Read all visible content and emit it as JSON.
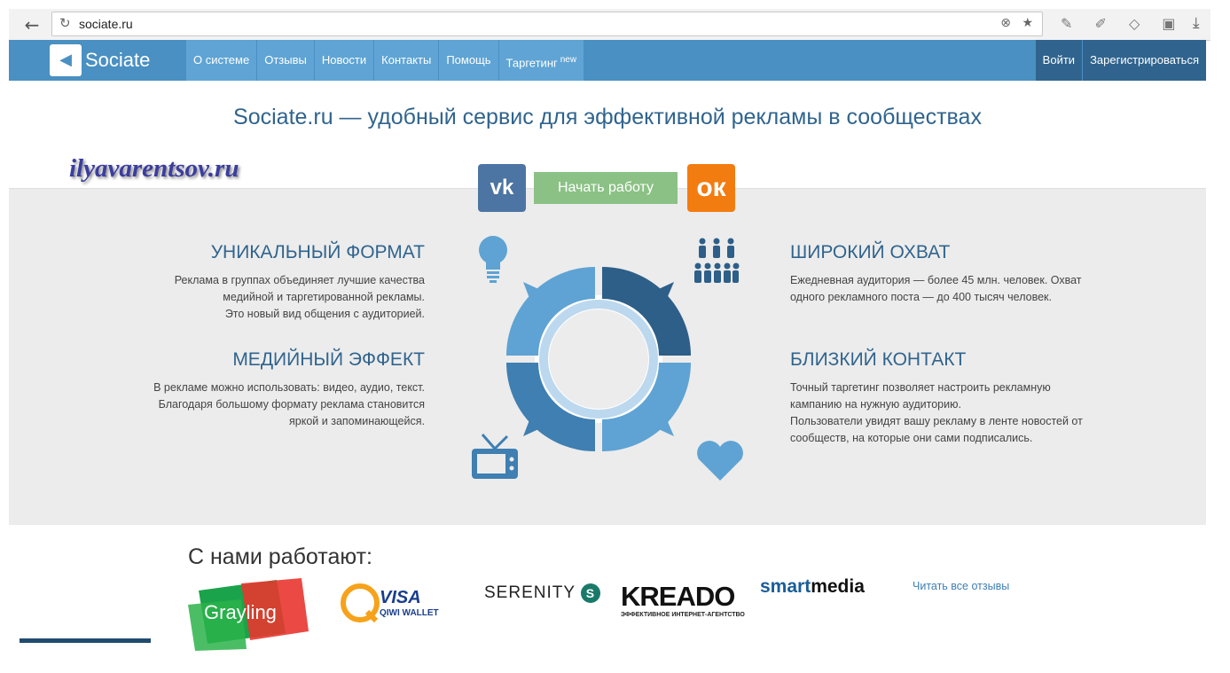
{
  "browser": {
    "url": "sociate.ru"
  },
  "nav": {
    "logo": "Sociate",
    "menu": [
      {
        "label": "О системе",
        "sup": ""
      },
      {
        "label": "Отзывы",
        "sup": ""
      },
      {
        "label": "Новости",
        "sup": ""
      },
      {
        "label": "Контакты",
        "sup": ""
      },
      {
        "label": "Помощь",
        "sup": ""
      },
      {
        "label": "Таргетинг",
        "sup": "new"
      }
    ],
    "login": "Войти",
    "register": "Зарегистрироваться"
  },
  "headline": "Sociate.ru — удобный сервис для эффективной рекламы в сообществах",
  "watermark": "ilyavarentsov.ru",
  "cta": {
    "vk_label": "vk",
    "ok_label": "ок",
    "start": "Начать работу"
  },
  "features": {
    "unique": {
      "title": "УНИКАЛЬНЫЙ ФОРМАТ",
      "lines": [
        "Реклама в группах объединяет лучшие качества",
        "медийной и таргетированной рекламы.",
        "Это новый вид общения с аудиторией."
      ]
    },
    "media": {
      "title": "МЕДИЙНЫЙ ЭФФЕКТ",
      "lines": [
        "В рекламе можно использовать: видео, аудио, текст.",
        "Благодаря большому формату реклама становится",
        "яркой и запоминающейся."
      ]
    },
    "reach": {
      "title": "ШИРОКИЙ ОХВАТ",
      "lines": [
        "Ежедневная аудитория — более 45 млн. человек. Охват",
        "одного рекламного поста — до 400 тысяч человек."
      ]
    },
    "contact": {
      "title": "БЛИЗКИЙ КОНТАКТ",
      "lines": [
        "Точный таргетинг позволяет настроить рекламную",
        "кампанию на нужную аудиторию.",
        "Пользователи увидят вашу рекламу в ленте новостей от",
        "сообществ, на которые они сами подписались."
      ]
    }
  },
  "partners": {
    "title": "С нами работают:",
    "grayling": "Grayling",
    "qiwi_visa": "VISA",
    "qiwi_wallet": "QIWI WALLET",
    "serenity": "SERENITY",
    "kreado": "KREADO",
    "kreado_sub": "ЭФФЕКТИВНОЕ ИНТЕРНЕТ-АГЕНТСТВО",
    "smart": "smart",
    "media": "media",
    "read_all": "Читать все отзывы"
  },
  "colors": {
    "nav_blue": "#4a90c2",
    "dark_blue": "#30648e",
    "green": "#8bc185",
    "orange": "#f37c10"
  }
}
